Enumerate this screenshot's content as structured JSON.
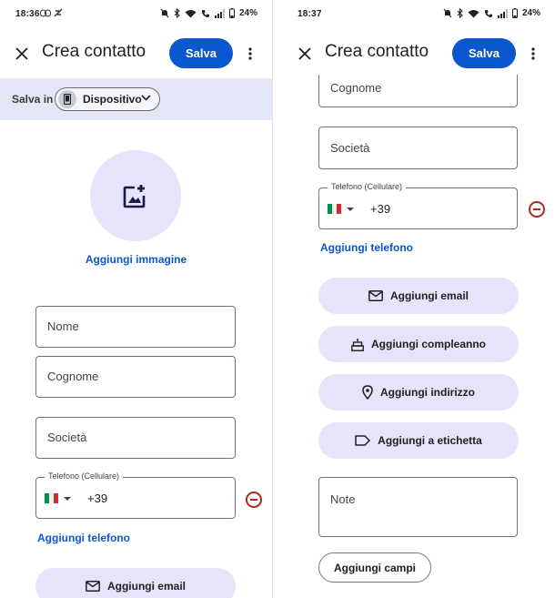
{
  "screens": [
    {
      "status": {
        "time": "18:36",
        "battery": "24%"
      },
      "appbar": {
        "title": "Crea contatto",
        "save_label": "Salva"
      },
      "save_in": {
        "label": "Salva in",
        "device": "Dispositivo"
      },
      "photo": {
        "add_label": "Aggiungi immagine"
      },
      "fields": {
        "name_placeholder": "Nome",
        "surname_placeholder": "Cognome",
        "company_placeholder": "Società"
      },
      "phone": {
        "legend": "Telefono (Cellulare)",
        "prefix": "+39"
      },
      "links": {
        "add_phone": "Aggiungi telefono"
      },
      "actions": {
        "add_email": "Aggiungi email"
      }
    },
    {
      "status": {
        "time": "18:37",
        "battery": "24%"
      },
      "appbar": {
        "title": "Crea contatto",
        "save_label": "Salva"
      },
      "fields": {
        "surname_placeholder": "Cognome",
        "company_placeholder": "Società",
        "notes_placeholder": "Note"
      },
      "phone": {
        "legend": "Telefono (Cellulare)",
        "prefix": "+39"
      },
      "links": {
        "add_phone": "Aggiungi telefono"
      },
      "actions": {
        "add_email": "Aggiungi email",
        "add_birthday": "Aggiungi compleanno",
        "add_address": "Aggiungi indirizzo",
        "add_label": "Aggiungi a etichetta",
        "add_fields": "Aggiungi campi"
      }
    }
  ],
  "colors": {
    "primary": "#0b57d0",
    "tonal": "#e5e4fb",
    "banner": "#e3e7f5",
    "error": "#b3261e"
  },
  "icons": [
    "close-icon",
    "more-vert-icon",
    "phone-device-icon",
    "chevron-down-icon",
    "add-photo-icon",
    "italy-flag-icon",
    "remove-circle-icon",
    "mail-icon",
    "cake-icon",
    "location-pin-icon",
    "label-icon"
  ]
}
